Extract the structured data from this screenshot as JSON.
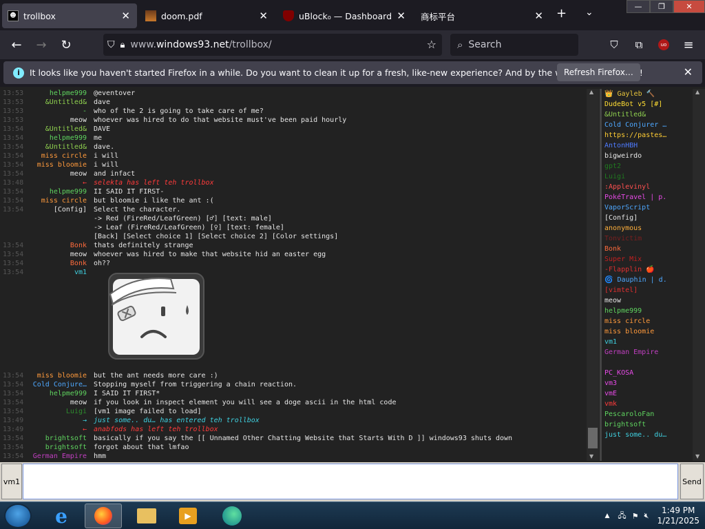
{
  "browser": {
    "tabs": [
      {
        "title": "trollbox",
        "active": true
      },
      {
        "title": "doom.pdf",
        "active": false
      },
      {
        "title": "uBlock₀ — Dashboard",
        "active": false
      },
      {
        "title": "商标平台",
        "active": false
      }
    ],
    "url_domain": "www.",
    "url_host": "windows93.net",
    "url_path": "/trollbox/",
    "search_placeholder": "Search",
    "ublock_badge": "uo"
  },
  "notification": {
    "message": "It looks like you haven't started Firefox in a while. Do you want to clean it up for a fresh, like-new experience? And by the way, welcome back!",
    "button": "Refresh Firefox…"
  },
  "chat": {
    "messages": [
      {
        "time": "13:53",
        "nick": "helpme999",
        "color": "#5fd35f",
        "text": "@eventover"
      },
      {
        "time": "13:53",
        "nick": "&Untitled&",
        "color": "#8fd04f",
        "text": "dave"
      },
      {
        "time": "13:53",
        "nick": "-",
        "color": "#5fd35f",
        "text": "who of the 2 is going to take care of me?"
      },
      {
        "time": "13:53",
        "nick": "meow",
        "color": "#e6e6e6",
        "text": "whoever was hired to do that website must've been paid hourly"
      },
      {
        "time": "13:54",
        "nick": "&Untitled&",
        "color": "#8fd04f",
        "text": "DAVE"
      },
      {
        "time": "13:54",
        "nick": "helpme999",
        "color": "#5fd35f",
        "text": "me"
      },
      {
        "time": "13:54",
        "nick": "&Untitled&",
        "color": "#8fd04f",
        "text": "dave."
      },
      {
        "time": "13:54",
        "nick": "miss circle",
        "color": "#ff9a3c",
        "text": "i will"
      },
      {
        "time": "13:54",
        "nick": "miss bloomie",
        "color": "#ff9a3c",
        "text": "i will"
      },
      {
        "time": "13:54",
        "nick": "meow",
        "color": "#e6e6e6",
        "text": "and infact"
      },
      {
        "time": "13:48",
        "nick": "←",
        "color": "#ff3b3b",
        "text": "selekta has left teh trollbox",
        "italic": true
      },
      {
        "time": "13:54",
        "nick": "helpme999",
        "color": "#5fd35f",
        "text": "II SAID IT FIRST-"
      },
      {
        "time": "13:54",
        "nick": "miss circle",
        "color": "#ff9a3c",
        "text": "but bloomie i like the ant :("
      },
      {
        "time": "13:54",
        "nick": "[Config]",
        "color": "#e6e6e6",
        "text": "Select the character."
      },
      {
        "time": "",
        "nick": "",
        "color": "#e6e6e6",
        "text": "-> Red (FireRed/LeafGreen) [♂] [text: male]"
      },
      {
        "time": "",
        "nick": "",
        "color": "#e6e6e6",
        "text": "-> Leaf (FireRed/LeafGreen) [♀] [text: female]"
      },
      {
        "time": "",
        "nick": "",
        "color": "#e6e6e6",
        "text": "[Back] [Select choice 1] [Select choice 2] [Color settings]"
      },
      {
        "time": "13:54",
        "nick": "Bonk",
        "color": "#ff6b3c",
        "text": "thats definitely strange"
      },
      {
        "time": "13:54",
        "nick": "meow",
        "color": "#e6e6e6",
        "text": "whoever was hired to make that website hid an easter egg"
      },
      {
        "time": "13:54",
        "nick": "Bonk",
        "color": "#ff6b3c",
        "text": "oh??"
      },
      {
        "time": "13:54",
        "nick": "vm1",
        "color": "#3fd0e0",
        "text": "",
        "image": true
      },
      {
        "time": "13:54",
        "nick": "miss bloomie",
        "color": "#ff9a3c",
        "text": "but the ant needs more care :)"
      },
      {
        "time": "13:54",
        "nick": "Cold Conjure…",
        "color": "#4ea8ff",
        "text": "Stopping myself from triggering a chain reaction."
      },
      {
        "time": "13:54",
        "nick": "helpme999",
        "color": "#5fd35f",
        "text": "I SAID IT FIRST*"
      },
      {
        "time": "13:54",
        "nick": "meow",
        "color": "#e6e6e6",
        "text": "if you look in inspect element you will see a doge ascii in the html code"
      },
      {
        "time": "13:54",
        "nick": "Luigi",
        "color": "#2e8b2e",
        "text": "[vm1 image failed to load]"
      },
      {
        "time": "13:49",
        "nick": "→",
        "color": "#3fd0e0",
        "text": "just some.. du… has entered teh trollbox",
        "italic": true
      },
      {
        "time": "13:49",
        "nick": "←",
        "color": "#ff3b3b",
        "text": "anabfods has left teh trollbox",
        "italic": true
      },
      {
        "time": "13:54",
        "nick": "brightsoft",
        "color": "#5fd35f",
        "text": "basically if you say the [[ Unnamed Other Chatting Website that Starts With D ]] windows93 shuts down"
      },
      {
        "time": "13:54",
        "nick": "brightsoft",
        "color": "#5fd35f",
        "text": "forgot about that lmfao"
      },
      {
        "time": "13:54",
        "nick": "German Empire",
        "color": "#c03fc0",
        "text": "hmm"
      }
    ]
  },
  "users": [
    {
      "name": "👑 Gayleb 🔨",
      "color": "#e6c33c"
    },
    {
      "name": "DudeBot v5 [#]",
      "color": "#ffdd33"
    },
    {
      "name": "&Untitled&",
      "color": "#8fd04f"
    },
    {
      "name": "Cold Conjurer …",
      "color": "#4ea8ff"
    },
    {
      "name": "https://pastes…",
      "color": "#ffcc33"
    },
    {
      "name": "AntonHBH",
      "color": "#4e7bff"
    },
    {
      "name": "bigweirdo",
      "color": "#e6e6e6"
    },
    {
      "name": "gpt2",
      "color": "#1f7a1f"
    },
    {
      "name": "Luigi",
      "color": "#1f7a1f"
    },
    {
      "name": ":Applevinyl",
      "color": "#ff5050"
    },
    {
      "name": "PokéTravel | p.",
      "color": "#e64ae6"
    },
    {
      "name": "VaporScript",
      "color": "#4ea8ff"
    },
    {
      "name": "[Config]",
      "color": "#e6e6e6"
    },
    {
      "name": "anonymous",
      "color": "#ffb03c"
    },
    {
      "name": "Tonvictim",
      "color": "#7a1f1f"
    },
    {
      "name": "Bonk",
      "color": "#ff6b3c"
    },
    {
      "name": "Super Mix",
      "color": "#c02020"
    },
    {
      "name": "-Flapplin 🍎",
      "color": "#e03030"
    },
    {
      "name": "🌀 Dauphin | d.",
      "color": "#4ea8ff"
    },
    {
      "name": "[vimtel]",
      "color": "#e03030"
    },
    {
      "name": "meow",
      "color": "#e6e6e6"
    },
    {
      "name": "helpme999",
      "color": "#5fd35f"
    },
    {
      "name": "miss circle",
      "color": "#ff9a3c"
    },
    {
      "name": "miss bloomie",
      "color": "#ff9a3c"
    },
    {
      "name": "vm1",
      "color": "#3fd0e0"
    },
    {
      "name": "German Empire",
      "color": "#c03fc0"
    },
    {
      "name": "",
      "color": "#e6e6e6"
    },
    {
      "name": "PC_KOSA",
      "color": "#e64ae6"
    },
    {
      "name": "vm3",
      "color": "#e64ae6"
    },
    {
      "name": "vmE",
      "color": "#e64ae6"
    },
    {
      "name": "vmk",
      "color": "#ff3b3b"
    },
    {
      "name": "PescaroloFan",
      "color": "#5fd35f"
    },
    {
      "name": "brightsoft",
      "color": "#5fd35f"
    },
    {
      "name": "just some.. du…",
      "color": "#3fd0e0"
    }
  ],
  "input": {
    "nick": "vm1",
    "send": "Send"
  },
  "taskbar": {
    "time": "1:49 PM",
    "date": "1/21/2025"
  }
}
